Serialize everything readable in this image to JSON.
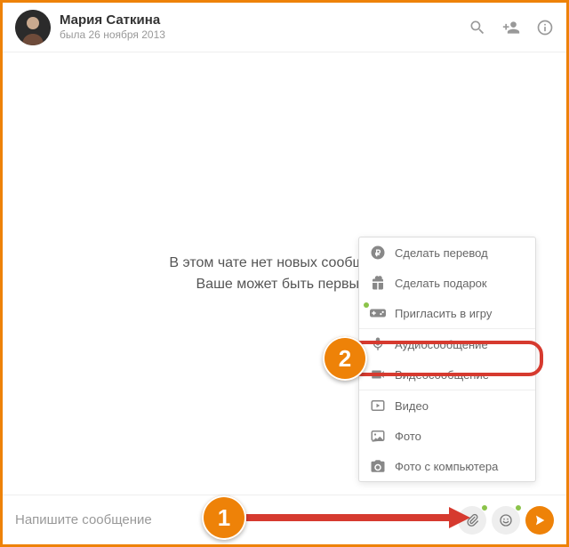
{
  "header": {
    "user_name": "Мария Саткина",
    "last_seen": "была 26 ноября 2013"
  },
  "main": {
    "empty_line1": "В этом чате нет новых сообщений.",
    "empty_line2": "Ваше может быть первым!"
  },
  "footer": {
    "placeholder": "Напишите сообщение"
  },
  "menu": {
    "transfer": "Сделать перевод",
    "gift": "Сделать подарок",
    "invite_game": "Пригласить в игру",
    "audio_msg": "Аудиосообщение",
    "video_msg": "Видеосообщение",
    "video": "Видео",
    "photo": "Фото",
    "photo_pc": "Фото с компьютера"
  },
  "callouts": {
    "step1": "1",
    "step2": "2"
  }
}
